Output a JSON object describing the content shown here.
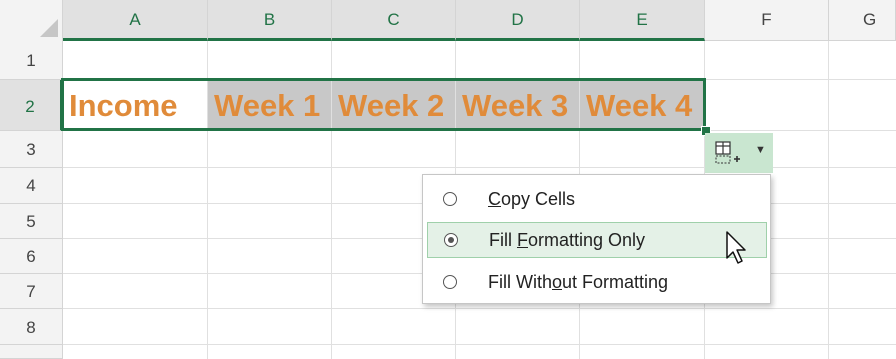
{
  "columns": [
    "A",
    "B",
    "C",
    "D",
    "E",
    "F",
    "G"
  ],
  "rows": [
    "1",
    "2",
    "3",
    "4",
    "5",
    "6",
    "7",
    "8"
  ],
  "row2": {
    "A": "Income",
    "B": "Week 1",
    "C": "Week 2",
    "D": "Week 3",
    "E": "Week 4"
  },
  "autofill": {
    "icon": "auto-fill-options-icon",
    "caret_icon": "caret-down-icon"
  },
  "menu": {
    "items": [
      {
        "label_pre": "",
        "mnemonic": "C",
        "label_post": "opy Cells",
        "selected": false
      },
      {
        "label_pre": "Fill ",
        "mnemonic": "F",
        "label_post": "ormatting Only",
        "selected": true
      },
      {
        "label_pre": "Fill With",
        "mnemonic": "o",
        "label_post": "ut Formatting",
        "selected": false
      }
    ]
  },
  "colors": {
    "accent": "#217346",
    "text_orange": "#e08b3a",
    "header_bg": "#f3f3f3",
    "highlight": "#e4f1e7"
  }
}
